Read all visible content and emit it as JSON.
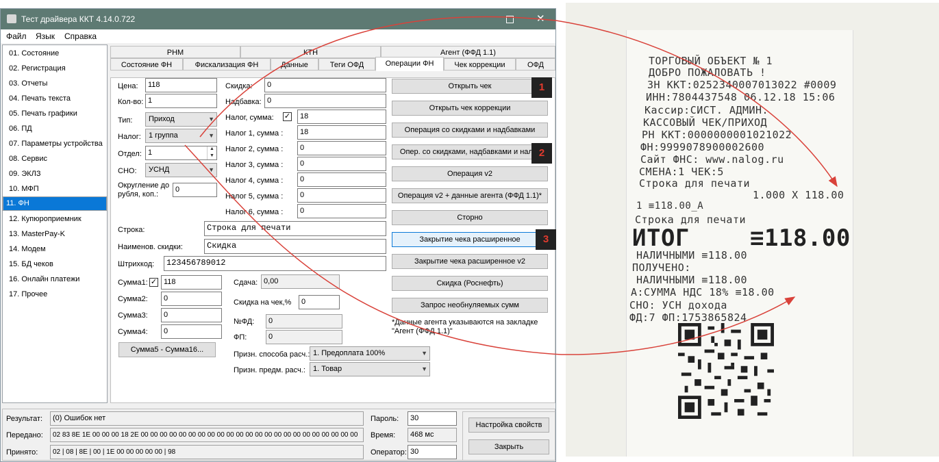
{
  "window": {
    "title": "Тест драйвера ККТ 4.14.0.722",
    "menu": [
      "Файл",
      "Язык",
      "Справка"
    ]
  },
  "nav": {
    "items": [
      "01. Состояние",
      "02. Регистрация",
      "03. Отчеты",
      "04. Печать текста",
      "05. Печать графики",
      "06. ПД",
      "07. Параметры устройства",
      "08. Сервис",
      "09. ЭКЛЗ",
      "10. МФП",
      "11. ФН",
      "12. Купюроприемник",
      "13. MasterPay-K",
      "14. Модем",
      "15. БД чеков",
      "16. Онлайн платежи",
      "17. Прочее"
    ],
    "selected": "11. ФН"
  },
  "tabs": {
    "row1": [
      "РНМ",
      "КТН",
      "Агент (ФФД 1.1)"
    ],
    "row2": [
      "Состояние ФН",
      "Фискализация ФН",
      "Данные",
      "Теги ОФД",
      "Операции ФН",
      "Чек коррекции",
      "ОФД"
    ],
    "active": "Операции ФН"
  },
  "form": {
    "price_label": "Цена:",
    "price": "118",
    "qty_label": "Кол-во:",
    "qty": "1",
    "type_label": "Тип:",
    "type": "Приход",
    "tax_label": "Налог:",
    "tax": "1 группа",
    "dept_label": "Отдел:",
    "dept": "1",
    "sno_label": "СНО:",
    "sno": "УСНД",
    "rounding_label_1": "Округление до",
    "rounding_label_2": "рубля, коп.:",
    "rounding": "0",
    "discount_label": "Скидка:",
    "discount": "0",
    "markup_label": "Надбавка:",
    "markup": "0",
    "tax_sum_label": "Налог, сумма:",
    "tax_sum": "18",
    "tax1_label": "Налог 1, сумма :",
    "tax1": "18",
    "tax2_label": "Налог 2, сумма :",
    "tax2": "0",
    "tax3_label": "Налог 3, сумма :",
    "tax3": "0",
    "tax4_label": "Налог 4, сумма :",
    "tax4": "0",
    "tax5_label": "Налог 5, сумма :",
    "tax5": "0",
    "tax6_label": "Налог 6, сумма :",
    "tax6": "0",
    "string_label": "Строка:",
    "string": "Строка для печати",
    "discount_name_label": "Наименов. скидки:",
    "discount_name": "Скидка",
    "barcode_label": "Штрихкод:",
    "barcode": "123456789012",
    "sum1_label": "Сумма1:",
    "sum1": "118",
    "sum2_label": "Сумма2:",
    "sum2": "0",
    "sum3_label": "Сумма3:",
    "sum3": "0",
    "sum4_label": "Сумма4:",
    "sum4": "0",
    "sum5_16_button": "Сумма5 - Сумма16...",
    "change_label": "Сдача:",
    "change": "0,00",
    "check_discount_label": "Скидка на чек,%",
    "check_discount": "0",
    "fd_label": "№ФД:",
    "fd": "0",
    "fp_label": "ФП:",
    "fp": "0",
    "payment_method_label": "Призн. способа расч.:",
    "payment_method": "1. Предоплата 100%",
    "subject_label": "Призн. предм. расч.:",
    "subject": "1. Товар"
  },
  "actions": [
    "Открыть чек",
    "Открыть чек коррекции",
    "Операция со скидками и надбавками",
    "Опер. со скидками, надбавками и налог",
    "Операция v2",
    "Операция v2 + данные агента (ФФД 1.1)*",
    "Сторно",
    "Закрытие чека расширенное",
    "Закрытие чека расширенное v2",
    "Скидка (Роснефть)",
    "Запрос необнуляемых сумм"
  ],
  "badges": [
    "1",
    "2",
    "3"
  ],
  "note": [
    "*Данные агента указываются на закладке",
    "\"Агент (ФФД 1.1)\""
  ],
  "status": {
    "result_label": "Результат:",
    "result": "(0) Ошибок нет",
    "sent_label": "Передано:",
    "sent": "02 83 8E 1E 00 00 00 18 2E 00 00 00 00 00 00 00 00 00 00 00 00 00 00 00 00 00 00 00 00 00 00 00",
    "recv_label": "Принято:",
    "recv": "02 | 08 | 8E | 00 | 1E 00 00 00 00 00 | 98",
    "password_label": "Пароль:",
    "password": "30",
    "time_label": "Время:",
    "time": "468 мс",
    "operator_label": "Оператор:",
    "operator": "30",
    "settings_button": "Настройка свойств",
    "close_button": "Закрыть"
  },
  "receipt": {
    "lines": [
      "ТОРГОВЫЙ ОБЪЕКТ № 1",
      "ДОБРО ПОЖАЛОВАТЬ !",
      "ЗН ККТ:0252340007013022    #0009",
      "ИНН:7804437548     06.12.18 15:06",
      "Кассир:СИСТ. АДМИН.",
      "КАССОВЫЙ ЧЕК/ПРИХОД",
      "РН ККТ:0000000001021022",
      "ФН:9999078900002600",
      "Сайт ФНС:          www.nalog.ru",
      "СМЕНА:1 ЧЕК:5",
      "Строка для печати",
      "1.000 X 118.00",
      "1                        ≡118.00_А",
      "Строка для печати"
    ],
    "total_label": "ИТОГ",
    "total": "≡118.00",
    "lines2": [
      "НАЛИЧНЫМИ            ≡118.00",
      "ПОЛУЧЕНО:",
      "НАЛИЧНЫМИ            ≡118.00",
      "А:СУММА НДС 18%        ≡18.00",
      "СНО:                УСН дохода",
      "ФД:7           ФП:1753865824"
    ]
  },
  "colors": {
    "titlebar": "#5e7a73",
    "selection": "#0a78d7",
    "arrow": "#d9423a",
    "badge_text": "#e23b2e"
  }
}
